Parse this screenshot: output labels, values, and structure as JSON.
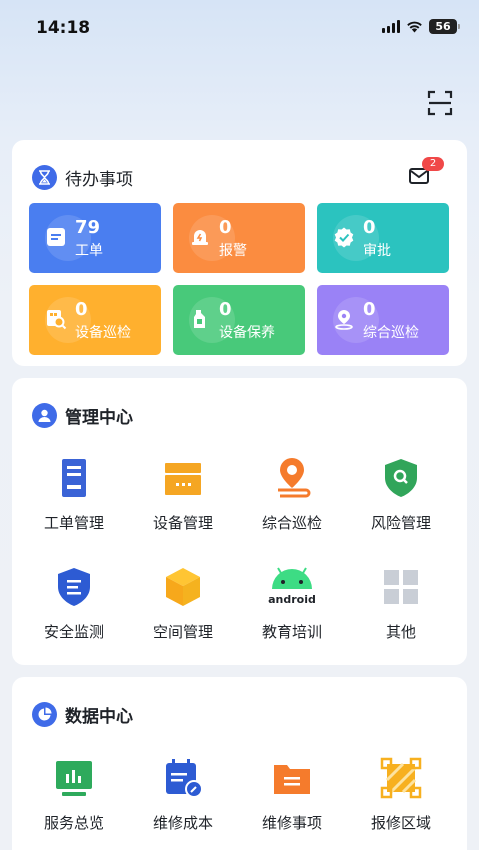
{
  "status_bar": {
    "time": "14:18",
    "battery": "56"
  },
  "todo": {
    "title": "待办事项",
    "mail_badge": "2",
    "tiles": [
      {
        "count": "79",
        "label": "工单",
        "color": "#4a7ef0",
        "icon": "document-icon"
      },
      {
        "count": "0",
        "label": "报警",
        "color": "#fb8c40",
        "icon": "alarm-icon"
      },
      {
        "count": "0",
        "label": "审批",
        "color": "#2bc3bf",
        "icon": "approval-icon"
      },
      {
        "count": "0",
        "label": "设备巡检",
        "color": "#ffb02e",
        "icon": "inspection-icon"
      },
      {
        "count": "0",
        "label": "设备保养",
        "color": "#48c97a",
        "icon": "maintenance-icon"
      },
      {
        "count": "0",
        "label": "综合巡检",
        "color": "#9a82f6",
        "icon": "location-icon"
      }
    ]
  },
  "management": {
    "title": "管理中心",
    "items": [
      {
        "label": "工单管理",
        "icon": "work-order-icon"
      },
      {
        "label": "设备管理",
        "icon": "device-icon"
      },
      {
        "label": "综合巡检",
        "icon": "patrol-icon"
      },
      {
        "label": "风险管理",
        "icon": "risk-icon"
      },
      {
        "label": "安全监测",
        "icon": "shield-icon"
      },
      {
        "label": "空间管理",
        "icon": "cube-icon"
      },
      {
        "label": "教育培训",
        "icon": "android-icon",
        "icon_text": "android"
      },
      {
        "label": "其他",
        "icon": "grid-icon"
      }
    ]
  },
  "data_center": {
    "title": "数据中心",
    "items": [
      {
        "label": "服务总览",
        "icon": "dashboard-icon"
      },
      {
        "label": "维修成本",
        "icon": "calendar-edit-icon"
      },
      {
        "label": "维修事项",
        "icon": "folder-icon"
      },
      {
        "label": "报修区域",
        "icon": "area-icon"
      }
    ]
  }
}
